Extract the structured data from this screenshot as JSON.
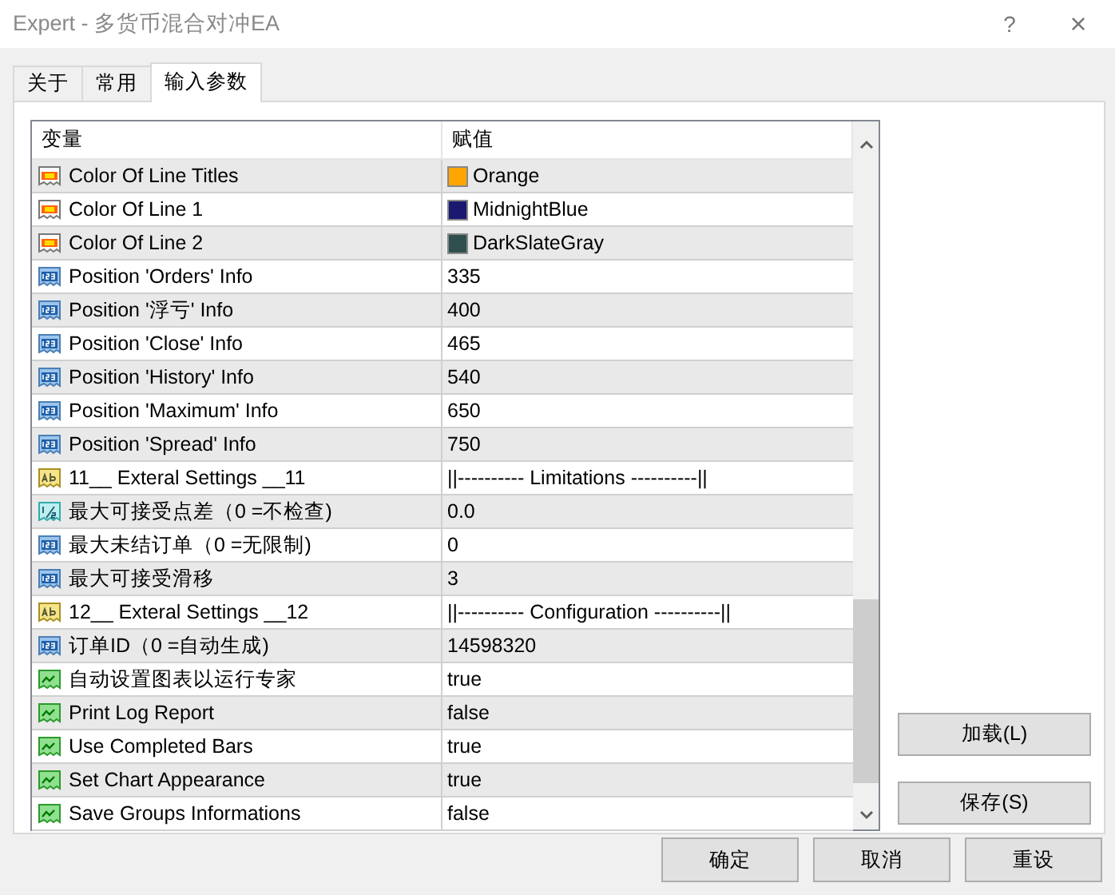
{
  "window": {
    "title": "Expert - 多货币混合对冲EA",
    "help": "?",
    "close": "×"
  },
  "tabs": [
    {
      "label": "关于",
      "selected": false
    },
    {
      "label": "常用",
      "selected": false
    },
    {
      "label": "输入参数",
      "selected": true
    }
  ],
  "table": {
    "columns": [
      "变量",
      "赋值"
    ],
    "rows": [
      {
        "kind": "color",
        "name": "Color Of Line Titles",
        "value": "Orange",
        "color": "#ffa500"
      },
      {
        "kind": "color",
        "name": "Color Of Line 1",
        "value": "MidnightBlue",
        "color": "#191970"
      },
      {
        "kind": "color",
        "name": "Color Of Line 2",
        "value": "DarkSlateGray",
        "color": "#2f4f4f"
      },
      {
        "kind": "int",
        "name": "Position 'Orders' Info",
        "value": "335"
      },
      {
        "kind": "int",
        "name": "Position '浮亏' Info",
        "value": "400"
      },
      {
        "kind": "int",
        "name": "Position 'Close' Info",
        "value": "465"
      },
      {
        "kind": "int",
        "name": "Position 'History' Info",
        "value": "540"
      },
      {
        "kind": "int",
        "name": "Position 'Maximum' Info",
        "value": "650"
      },
      {
        "kind": "int",
        "name": "Position 'Spread' Info",
        "value": "750"
      },
      {
        "kind": "string",
        "name": "11__ Exteral Settings __11",
        "value": "||---------- Limitations ----------||"
      },
      {
        "kind": "double",
        "name": "最大可接受点差（0 =不检查)",
        "value": "0.0"
      },
      {
        "kind": "int",
        "name": "最大未结订单（0 =无限制)",
        "value": "0"
      },
      {
        "kind": "int",
        "name": "最大可接受滑移",
        "value": "3"
      },
      {
        "kind": "string",
        "name": "12__ Exteral Settings __12",
        "value": "||---------- Configuration ----------||"
      },
      {
        "kind": "int",
        "name": "订单ID（0 =自动生成)",
        "value": "14598320"
      },
      {
        "kind": "bool",
        "name": "自动设置图表以运行专家",
        "value": "true"
      },
      {
        "kind": "bool",
        "name": "Print Log Report",
        "value": "false"
      },
      {
        "kind": "bool",
        "name": "Use Completed Bars",
        "value": "true"
      },
      {
        "kind": "bool",
        "name": "Set Chart Appearance",
        "value": "true"
      },
      {
        "kind": "bool",
        "name": "Save Groups Informations",
        "value": "false"
      }
    ]
  },
  "side_buttons": [
    "加载(L)",
    "保存(S)"
  ],
  "buttons": [
    "确定",
    "取消",
    "重设"
  ]
}
